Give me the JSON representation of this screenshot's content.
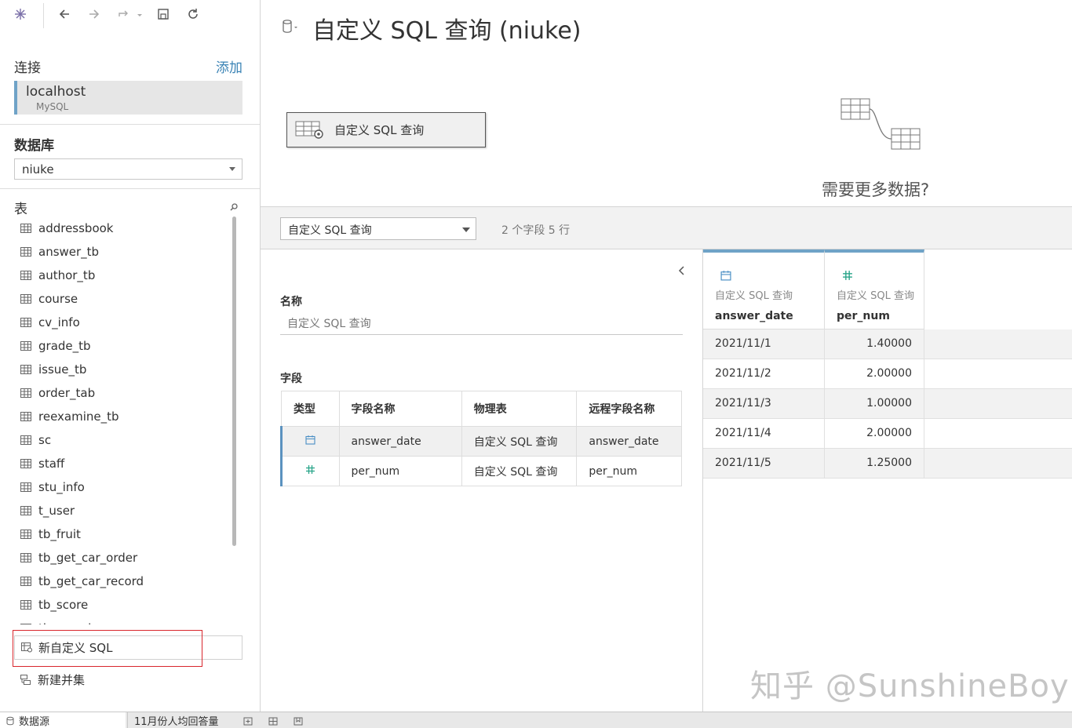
{
  "sidebar": {
    "connection_title": "连接",
    "add_label": "添加",
    "connection": {
      "name": "localhost",
      "type": "MySQL"
    },
    "database_title": "数据库",
    "database_value": "niuke",
    "tables_title": "表",
    "tables": [
      "addressbook",
      "answer_tb",
      "author_tb",
      "course",
      "cv_info",
      "grade_tb",
      "issue_tb",
      "order_tab",
      "reexamine_tb",
      "sc",
      "staff",
      "stu_info",
      "t_user",
      "tb_fruit",
      "tb_get_car_order",
      "tb_get_car_record",
      "tb_score",
      "tb_user_log"
    ],
    "new_custom_sql": "新自定义 SQL",
    "new_union": "新建并集"
  },
  "main": {
    "title": "自定义 SQL 查询 (niuke)",
    "canvas_node": "自定义 SQL 查询",
    "need_more_data": "需要更多数据?",
    "table_select": "自定义 SQL 查询",
    "summary": "2 个字段 5 行"
  },
  "metadata": {
    "name_label": "名称",
    "name_value": "自定义 SQL 查询",
    "fields_label": "字段",
    "columns": [
      "类型",
      "字段名称",
      "物理表",
      "远程字段名称"
    ],
    "rows": [
      {
        "type_icon": "calendar-icon",
        "name": "answer_date",
        "table": "自定义 SQL 查询",
        "remote": "answer_date"
      },
      {
        "type_icon": "number-icon",
        "name": "per_num",
        "table": "自定义 SQL 查询",
        "remote": "per_num"
      }
    ]
  },
  "grid": {
    "columns": [
      {
        "icon": "calendar-icon",
        "source": "自定义 SQL 查询",
        "name": "answer_date"
      },
      {
        "icon": "number-icon",
        "source": "自定义 SQL 查询",
        "name": "per_num"
      }
    ],
    "rows": [
      [
        "2021/11/1",
        "1.40000"
      ],
      [
        "2021/11/2",
        "2.00000"
      ],
      [
        "2021/11/3",
        "1.00000"
      ],
      [
        "2021/11/4",
        "2.00000"
      ],
      [
        "2021/11/5",
        "1.25000"
      ]
    ]
  },
  "watermark": "知乎 @SunshineBoy",
  "tabs": {
    "datasource": "数据源",
    "sheet": "11月份人均回答量"
  },
  "colors": {
    "accent": "#6fa3c7",
    "link": "#3a83b5",
    "highlight": "#d9262c",
    "number_icon": "#2aa58a"
  }
}
